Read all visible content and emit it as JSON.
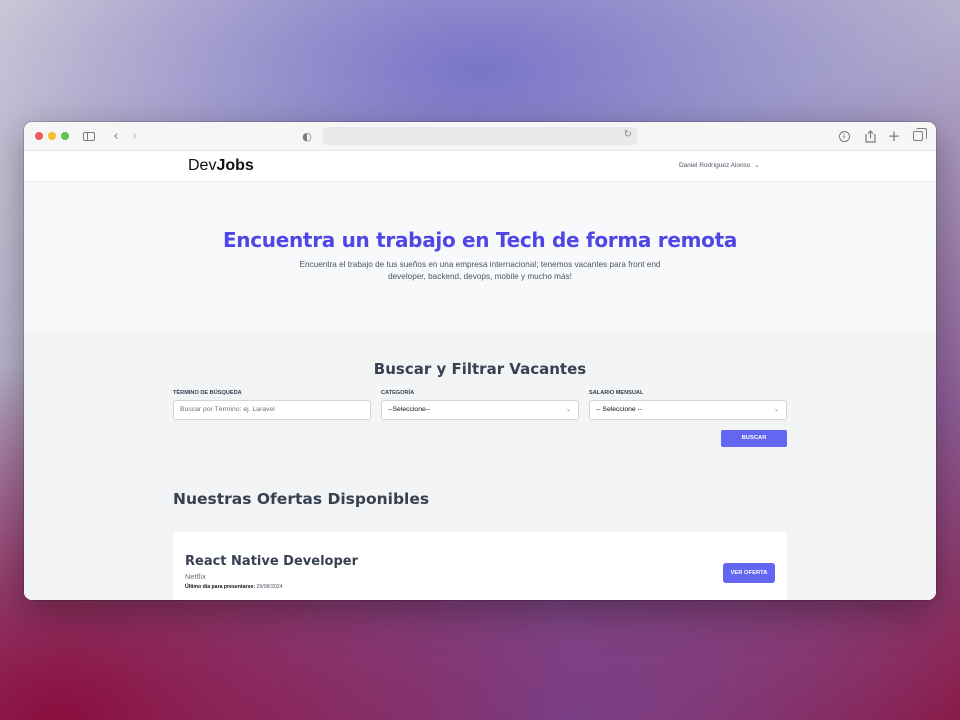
{
  "site": {
    "logo_prefix": "Dev",
    "logo_bold": "Jobs",
    "user_name": "Daniel Rodríguez Alonso"
  },
  "hero": {
    "title": "Encuentra un trabajo en Tech de forma remota",
    "description": "Encuentra el trabajo de tus sueños en una empresa internacional; tenemos vacantes para front end developer, backend, devops, mobile y mucho más!"
  },
  "search": {
    "title": "Buscar y Filtrar Vacantes",
    "term_label": "Término de búsqueda",
    "term_placeholder": "Buscar por Término: ej. Laravel",
    "category_label": "Categoría",
    "category_value": "--Seleccione--",
    "salary_label": "Salario Mensual",
    "salary_value": "-- Seleccione --",
    "button_label": "Buscar"
  },
  "offers": {
    "title": "Nuestras Ofertas Disponibles",
    "jobs": [
      {
        "title": "React Native Developer",
        "company": "Netflix",
        "deadline_label": "Último día para presentarse:",
        "deadline_value": "29/08/2024",
        "button_label": "Ver Oferta"
      }
    ]
  },
  "colors": {
    "accent": "#6366f1",
    "hero_title": "#4f46e5"
  }
}
